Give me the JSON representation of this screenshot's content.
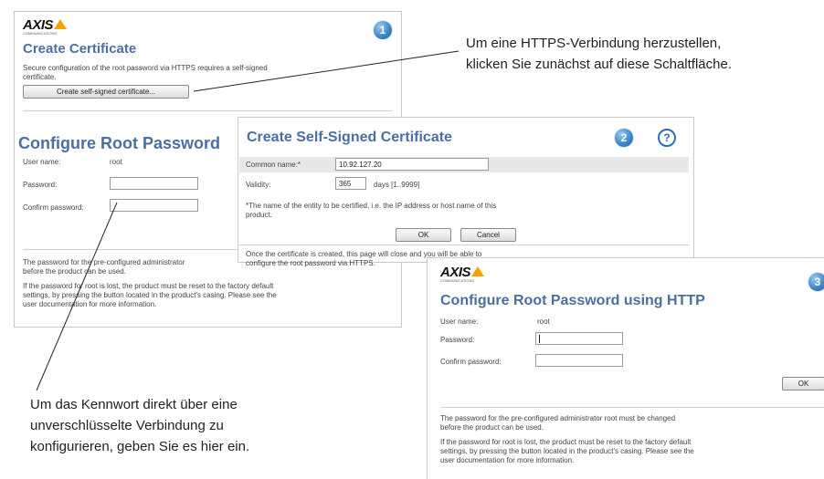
{
  "logo": {
    "text": "AXIS",
    "sub": "COMMUNICATIONS"
  },
  "panel_create_certificate": {
    "step": "1",
    "title": "Create Certificate",
    "desc_line1": "Secure configuration of the root password via HTTPS requires a self-signed",
    "desc_line2": "certificate.",
    "button_label": "Create self-signed certificate..."
  },
  "panel_root_password": {
    "title": "Configure Root Password",
    "username_label": "User name:",
    "username_value": "root",
    "password_label": "Password:",
    "confirm_label": "Confirm password:",
    "note1_line1": "The password for the pre-configured administrator",
    "note1_line2": "before the product can be used.",
    "note2_line1": "If the password for root is lost, the product must be reset to the factory default",
    "note2_line2": "settings, by pressing the button located in the product's casing. Please see the",
    "note2_line3": "user documentation for more information."
  },
  "panel_self_signed": {
    "step": "2",
    "help": "?",
    "title": "Create Self-Signed Certificate",
    "common_name_label": "Common name:*",
    "common_name_value": "10.92.127.20",
    "validity_label": "Validity:",
    "validity_value": "365",
    "validity_unit": "days [1..9999]",
    "footnote_line1": "*The name of the entity to be certified, i.e. the IP address or host name of this",
    "footnote_line2": "product.",
    "ok_label": "OK",
    "cancel_label": "Cancel",
    "info_line1": "Once the certificate is created, this page will close and you will be able to",
    "info_line2": "configure the root password via HTTPS."
  },
  "panel_http": {
    "step": "3",
    "title": "Configure Root Password using HTTP",
    "username_label": "User name:",
    "username_value": "root",
    "password_label": "Password:",
    "confirm_label": "Confirm password:",
    "ok_label": "OK",
    "note1_line1": "The password for the pre-configured administrator root must be changed",
    "note1_line2": "before the product can be used.",
    "note2_line1": "If the password for root is lost, the product must be reset to the factory default",
    "note2_line2": "settings, by pressing the button located in the product's casing. Please see the",
    "note2_line3": "user documentation for more information."
  },
  "annotations": {
    "https_line1": "Um eine HTTPS-Verbindung herzustellen,",
    "https_line2": "klicken Sie zunächst auf diese Schaltfläche.",
    "direct_line1": "Um das Kennwort direkt über eine",
    "direct_line2": "unverschlüsselte Verbindung zu",
    "direct_line3": "konfigurieren, geben Sie es hier ein."
  },
  "colors": {
    "accent_title": "#4a6fa5",
    "logo_triangle": "#f5a300",
    "badge_blue": "#3f87cc"
  }
}
